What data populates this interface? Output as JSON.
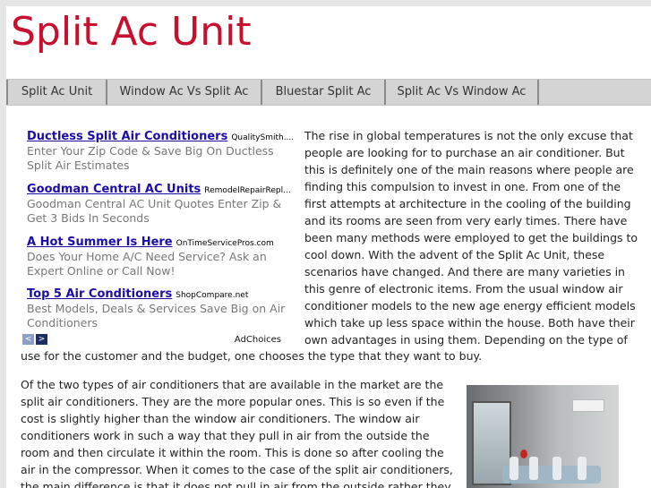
{
  "site": {
    "title": "Split Ac Unit"
  },
  "nav": [
    {
      "label": "Split Ac Unit"
    },
    {
      "label": "Window Ac Vs Split Ac"
    },
    {
      "label": "Bluestar Split Ac"
    },
    {
      "label": "Split Ac Vs Window Ac"
    }
  ],
  "ads": {
    "items": [
      {
        "title": "Ductless Split Air Conditioners",
        "source": "QualitySmith....",
        "desc": "Enter Your Zip Code & Save Big On Ductless Split Air Estimates"
      },
      {
        "title": "Goodman Central AC Units",
        "source": "RemodelRepairRepl...",
        "desc": "Goodman Central AC Unit Quotes Enter Zip & Get 3 Bids In Seconds"
      },
      {
        "title": "A Hot Summer Is Here",
        "source": "OnTimeServicePros.com",
        "desc": "Does Your Home A/C Need Service? Ask an Expert Online or Call Now!"
      },
      {
        "title": "Top 5 Air Conditioners",
        "source": "ShopCompare.net",
        "desc": "Best Models, Deals & Services Save Big on Air Conditioners"
      }
    ],
    "prev_glyph": "<",
    "next_glyph": ">",
    "adchoices": "AdChoices"
  },
  "article": {
    "p1": "The rise in global temperatures is not the only excuse that people are looking for to purchase an air conditioner. But this is definitely one of the main reasons where people are finding this compulsion to invest in one. From one of the first attempts at architecture in the cooling of the building and its rooms are seen from very early times. There have been many methods were employed to get the buildings to cool down. With the advent of the Split Ac Unit, these scenarios have changed. And there are many varieties in this genre of electronic items. From the usual window air conditioner models to the new age energy efficient models which take up less space within the house. Both have their own advantages in using them. Depending on the type of",
    "p1_end": "use for the customer and the budget, one chooses the type that they want to buy.",
    "p2": "Of the two types of air conditioners that are available in the market are the split air conditioners. They are the more popular ones. This is so even if the cost is slightly higher than the window air conditioners. The window air conditioners work in such a way that they pull in air from the outside the room and then circulate it within the room. This is done so after cooling the air in the compressor. When it comes to the case of the split air conditioners, the main difference is that it does not pull in air from the outside rather they circulate"
  },
  "colors": {
    "title": "#c8102e",
    "link": "#1a0dab",
    "nav_bg": "#d4d4d4"
  }
}
